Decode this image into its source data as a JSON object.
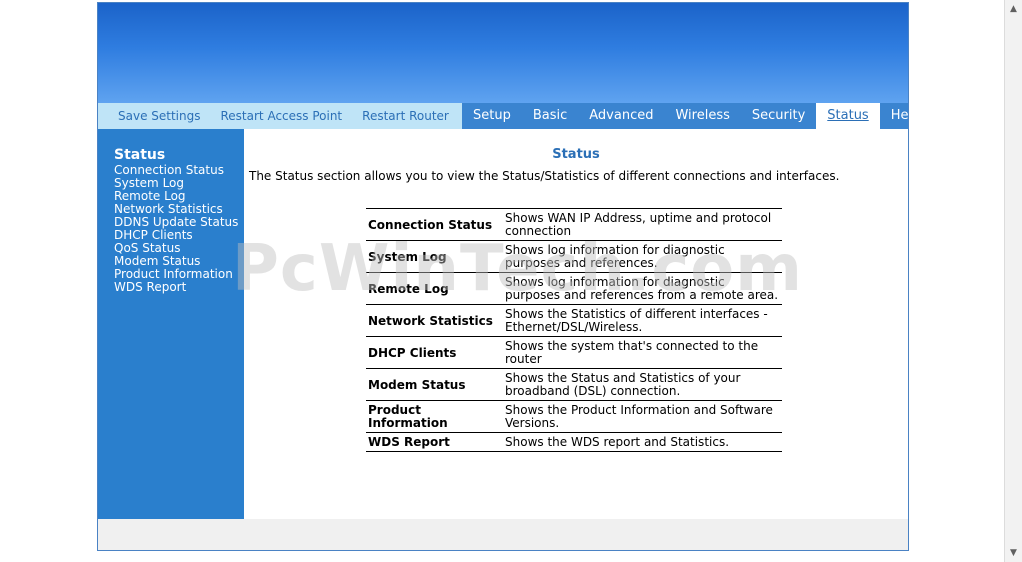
{
  "quick_links": [
    "Save Settings",
    "Restart Access Point",
    "Restart Router"
  ],
  "tabs": [
    "Setup",
    "Basic",
    "Advanced",
    "Wireless",
    "Security",
    "Status",
    "Help"
  ],
  "active_tab": "Status",
  "sidebar": {
    "title": "Status",
    "items": [
      "Connection Status",
      "System Log",
      "Remote Log",
      "Network Statistics",
      "DDNS Update Status",
      "DHCP Clients",
      "QoS Status",
      "Modem Status",
      "Product Information",
      "WDS Report"
    ]
  },
  "main": {
    "heading": "Status",
    "intro": "The Status section allows you to view the Status/Statistics of different connections and interfaces.",
    "rows": [
      {
        "name": "Connection Status",
        "desc": "Shows WAN IP Address, uptime and protocol connection"
      },
      {
        "name": "System Log",
        "desc": "Shows log information for diagnostic purposes and references."
      },
      {
        "name": "Remote Log",
        "desc": "Shows log information for diagnostic purposes and references from a remote area."
      },
      {
        "name": "Network Statistics",
        "desc": "Shows the Statistics of different interfaces - Ethernet/DSL/Wireless."
      },
      {
        "name": "DHCP Clients",
        "desc": "Shows the system that's connected to the router"
      },
      {
        "name": "Modem Status",
        "desc": "Shows the Status and Statistics of your broadband (DSL) connection."
      },
      {
        "name": "Product Information",
        "desc": "Shows the Product Information and Software Versions."
      },
      {
        "name": "WDS Report",
        "desc": "Shows the WDS report and Statistics."
      }
    ]
  },
  "watermark": "PcWinTech.com",
  "colors": {
    "banner": "#2f7de0",
    "menubar": "#3a84d0",
    "quicklinks_bg": "#bfe4f7",
    "sidebar": "#2a7fcd",
    "heading": "#2b6fb6"
  }
}
